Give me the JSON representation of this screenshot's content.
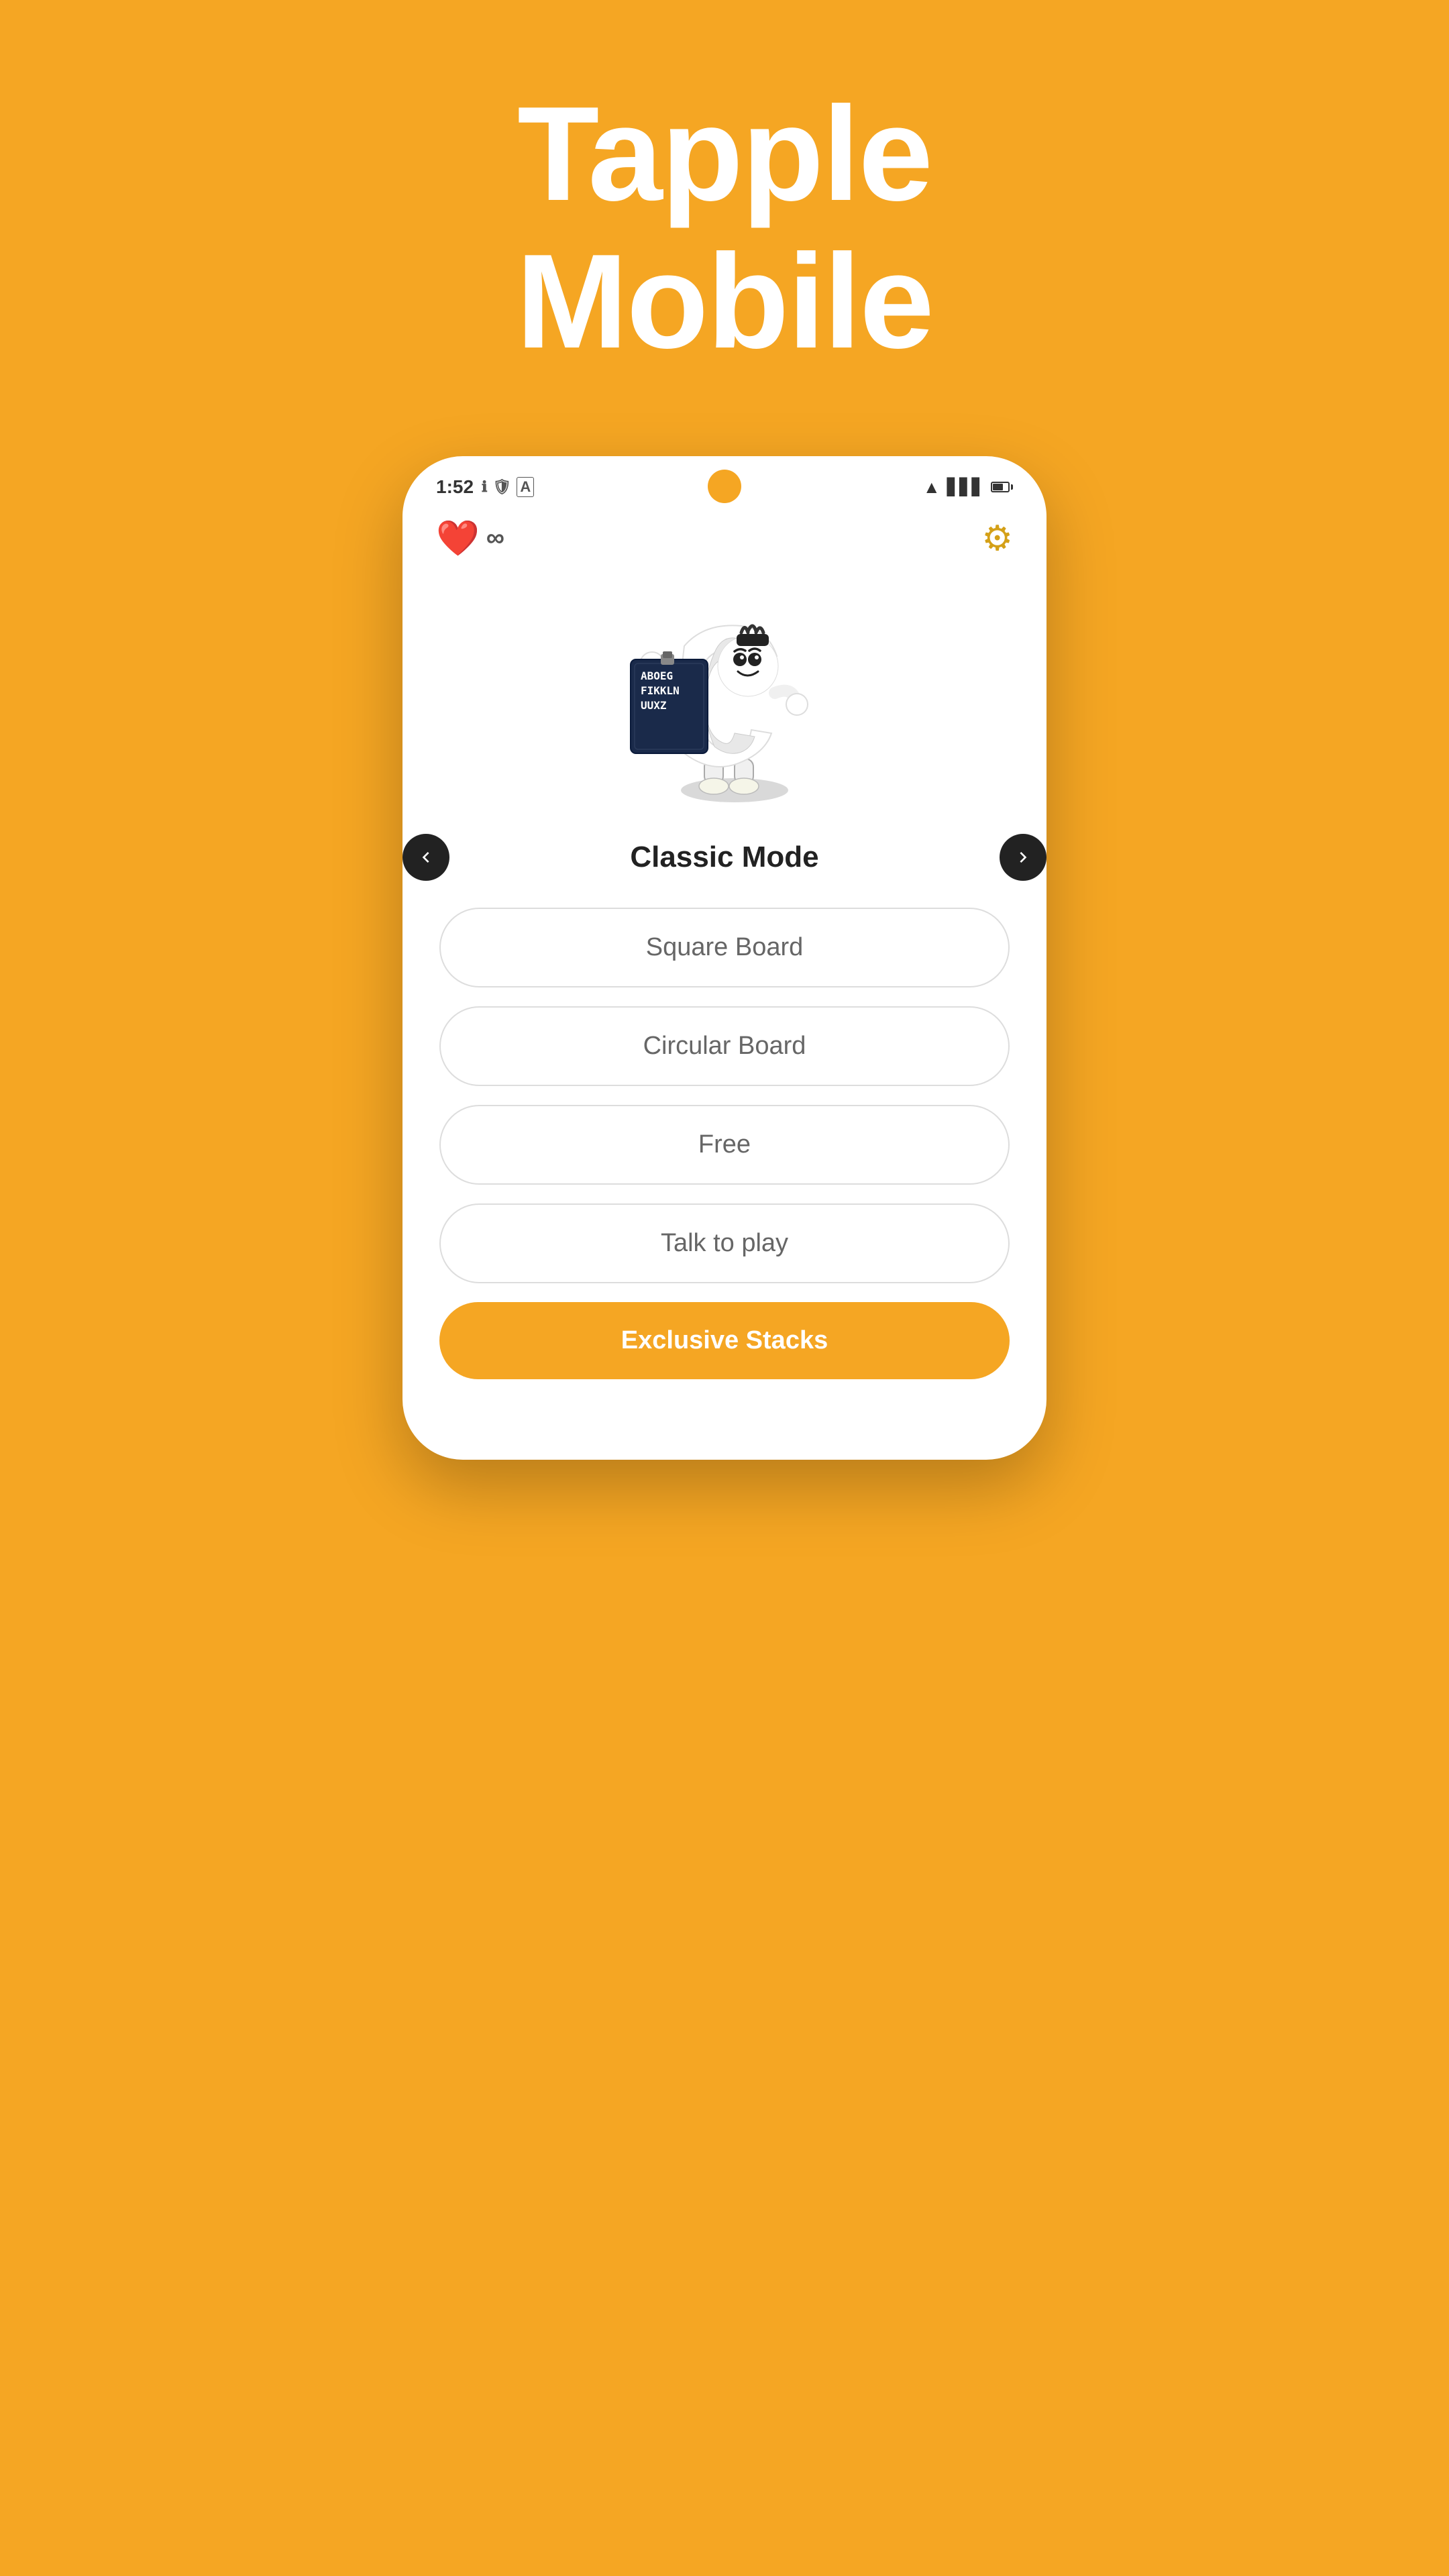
{
  "app": {
    "title_line1": "Tapple",
    "title_line2": "Mobile"
  },
  "status_bar": {
    "time": "1:52",
    "icons": [
      "ℹ",
      "🛡",
      "A"
    ]
  },
  "top_bar": {
    "lives_symbol": "∞",
    "gear_label": "Settings"
  },
  "mode": {
    "current": "Classic Mode",
    "prev_arrow": "←",
    "next_arrow": "→"
  },
  "menu": {
    "buttons": [
      {
        "label": "Square Board",
        "highlight": false
      },
      {
        "label": "Circular Board",
        "highlight": false
      },
      {
        "label": "Free",
        "highlight": false
      },
      {
        "label": "Talk to play",
        "highlight": false
      },
      {
        "label": "Exclusive Stacks",
        "highlight": true
      }
    ]
  }
}
